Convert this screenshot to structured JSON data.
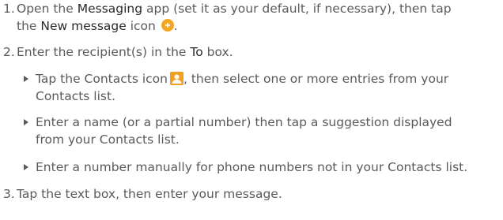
{
  "colors": {
    "text": "#5a5a5a",
    "emphasis": "#2a2a2a",
    "new_message_icon": "#f5a623",
    "contacts_icon": "#f0a020"
  },
  "steps": [
    {
      "number": "1.",
      "part1": "Open the ",
      "app_name": "Messaging",
      "part2": " app (set it as your default, if necessary), then tap",
      "line2_part1": "the ",
      "button_name": "New message",
      "line2_part2": " icon",
      "icon": "new-message-icon",
      "line2_end": "."
    },
    {
      "number": "2.",
      "part1": "Enter the recipient(s) in the ",
      "field_name": "To",
      "part2": " box.",
      "bullets": [
        {
          "line1_part1": "Tap the Contacts icon",
          "icon": "contacts-icon",
          "line1_part2": ", then select one or more entries from your",
          "line2": "Contacts list."
        },
        {
          "line1": "Enter a name (or a partial number) then tap a suggestion displayed",
          "line2": "from your Contacts list."
        },
        {
          "line1": "Enter a number manually for phone numbers not in your Contacts list."
        }
      ]
    },
    {
      "number": "3.",
      "text": "Tap the text box, then enter your message."
    }
  ]
}
